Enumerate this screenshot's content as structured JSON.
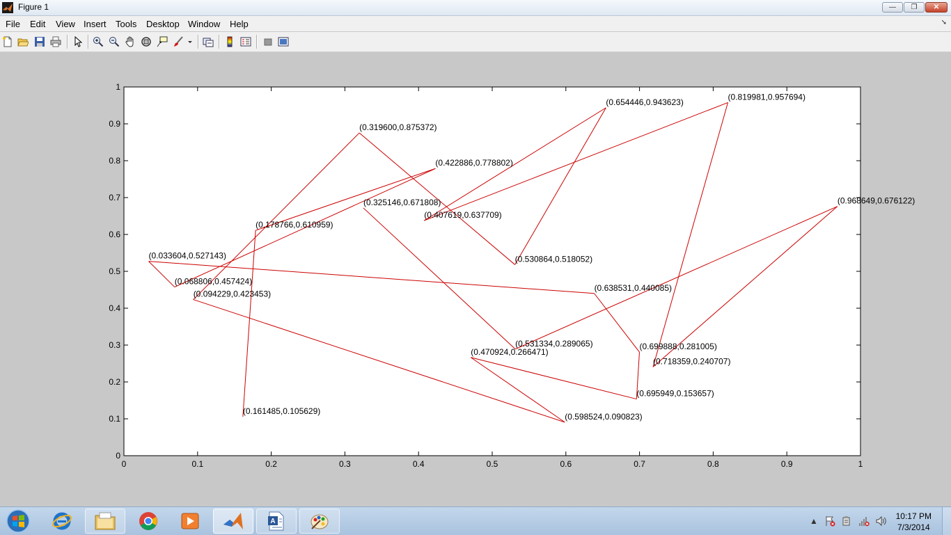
{
  "window": {
    "title": "Figure 1",
    "controls": {
      "minimize": "—",
      "restore": "❐",
      "close": "✕"
    }
  },
  "menu": [
    "File",
    "Edit",
    "View",
    "Insert",
    "Tools",
    "Desktop",
    "Window",
    "Help"
  ],
  "toolbar": {
    "icons": [
      "new-figure-icon",
      "open-file-icon",
      "save-icon",
      "print-icon",
      "edit-plot-arrow-icon",
      "zoom-in-icon",
      "zoom-out-icon",
      "pan-hand-icon",
      "rotate-3d-icon",
      "data-cursor-icon",
      "brush-icon",
      "brush-dropdown-icon",
      "link-plot-icon",
      "colorbar-icon",
      "legend-icon",
      "hide-plot-tools-icon",
      "show-plot-tools-icon"
    ]
  },
  "chart_data": {
    "type": "line",
    "xlim": [
      0,
      1
    ],
    "ylim": [
      0,
      1
    ],
    "xticks": [
      "0",
      "0.1",
      "0.2",
      "0.3",
      "0.4",
      "0.5",
      "0.6",
      "0.7",
      "0.8",
      "0.9",
      "1"
    ],
    "yticks": [
      "0",
      "0.1",
      "0.2",
      "0.3",
      "0.4",
      "0.5",
      "0.6",
      "0.7",
      "0.8",
      "0.9",
      "1"
    ],
    "grid": false,
    "line_color": "#cc0000",
    "points": [
      {
        "x": 0.161485,
        "y": 0.105629,
        "label": "(0.161485,0.105629)"
      },
      {
        "x": 0.178766,
        "y": 0.610959,
        "label": "(0.178766,0.610959)"
      },
      {
        "x": 0.422886,
        "y": 0.778802,
        "label": "(0.422886,0.778802)"
      },
      {
        "x": 0.068806,
        "y": 0.457424,
        "label": "(0.068806,0.457424)"
      },
      {
        "x": 0.033604,
        "y": 0.527143,
        "label": "(0.033604,0.527143)"
      },
      {
        "x": 0.638531,
        "y": 0.440085,
        "label": "(0.638531,0.440085)"
      },
      {
        "x": 0.699888,
        "y": 0.281005,
        "label": "(0.699888,0.281005)"
      },
      {
        "x": 0.695949,
        "y": 0.153657,
        "label": "(0.695949,0.153657)"
      },
      {
        "x": 0.470924,
        "y": 0.266471,
        "label": "(0.470924,0.266471)"
      },
      {
        "x": 0.598524,
        "y": 0.090823,
        "label": "(0.598524,0.090823)"
      },
      {
        "x": 0.094229,
        "y": 0.423453,
        "label": "(0.094229,0.423453)"
      },
      {
        "x": 0.3196,
        "y": 0.875372,
        "label": "(0.319600,0.875372)"
      },
      {
        "x": 0.530864,
        "y": 0.518052,
        "label": "(0.530864,0.518052)"
      },
      {
        "x": 0.654446,
        "y": 0.943623,
        "label": "(0.654446,0.943623)"
      },
      {
        "x": 0.407619,
        "y": 0.637709,
        "label": "(0.407619,0.637709)"
      },
      {
        "x": 0.819981,
        "y": 0.957694,
        "label": "(0.819981,0.957694)"
      },
      {
        "x": 0.718359,
        "y": 0.240707,
        "label": "(0.718359,0.240707)"
      },
      {
        "x": 0.968649,
        "y": 0.676122,
        "label": "(0.968649,0.676122)"
      },
      {
        "x": 0.531334,
        "y": 0.289065,
        "label": "(0.531334,0.289065)"
      },
      {
        "x": 0.325146,
        "y": 0.671808,
        "label": "(0.325146,0.671808)"
      }
    ]
  },
  "taskbar": {
    "start": "windows-start-icon",
    "apps": [
      "internet-explorer-icon",
      "file-explorer-icon",
      "chrome-icon",
      "media-player-icon",
      "matlab-icon",
      "word-document-icon",
      "paint-icon"
    ],
    "tray_icons": [
      "show-hidden-icons-icon",
      "flag-icon",
      "device-icon",
      "network-icon",
      "volume-icon"
    ],
    "tray_arrow": "▲",
    "time": "10:17 PM",
    "date": "7/3/2014"
  }
}
